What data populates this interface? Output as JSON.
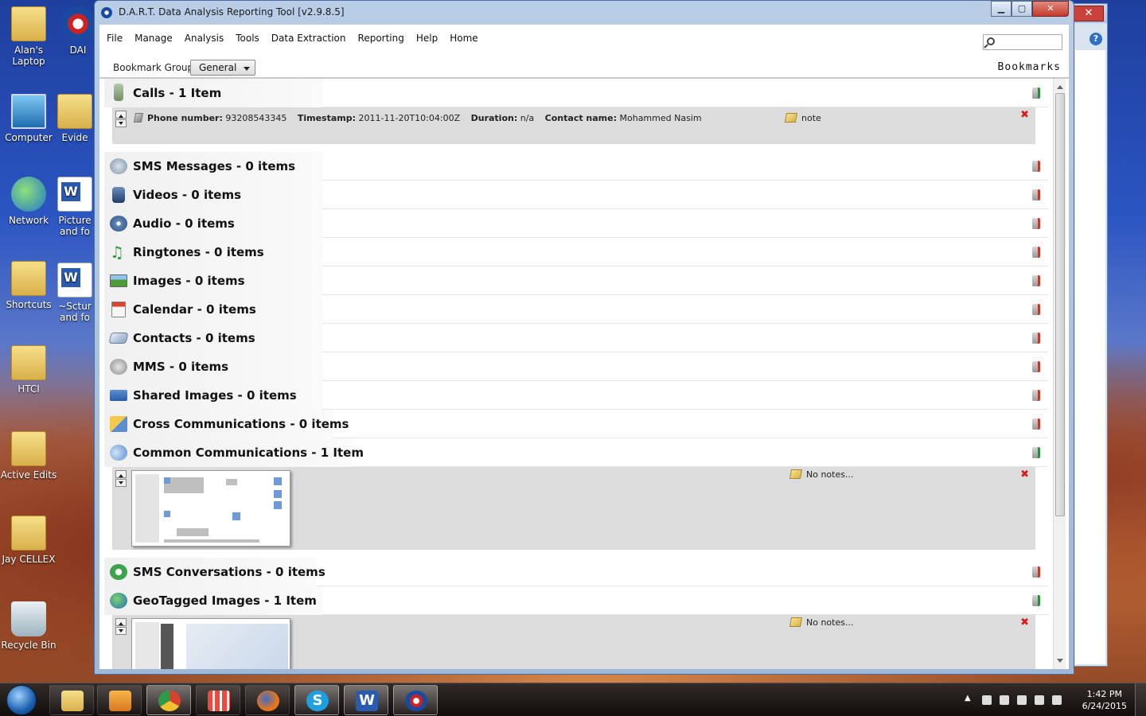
{
  "desktop": {
    "icons": [
      {
        "label": "Alan's\nLaptop"
      },
      {
        "label": "DAI"
      },
      {
        "label": "Computer"
      },
      {
        "label": "Evide"
      },
      {
        "label": "Network"
      },
      {
        "label": "Picture\nand fo"
      },
      {
        "label": "Shortcuts"
      },
      {
        "label": "~Sctur\nand fo"
      },
      {
        "label": "HTCI"
      },
      {
        "label": "Active Edits"
      },
      {
        "label": "Jay CELLEX"
      },
      {
        "label": "Recycle Bin"
      }
    ]
  },
  "window": {
    "title": "D.A.R.T. Data Analysis Reporting Tool [v2.9.8.5]",
    "menu": [
      "File",
      "Manage",
      "Analysis",
      "Tools",
      "Data Extraction",
      "Reporting",
      "Help",
      "Home"
    ],
    "search_placeholder": "",
    "bookmark_group_label": "Bookmark Group",
    "bookmark_group_value": "General",
    "panel_title": "Bookmarks"
  },
  "categories": [
    {
      "name": "Calls - 1 Item",
      "icon": "phone-icon",
      "flag": "green"
    },
    {
      "name": "SMS Messages - 0 items",
      "icon": "sms-icon",
      "flag": "red"
    },
    {
      "name": "Videos - 0 items",
      "icon": "film-icon",
      "flag": "red"
    },
    {
      "name": "Audio - 0 items",
      "icon": "audio-icon",
      "flag": "red"
    },
    {
      "name": "Ringtones - 0 items",
      "icon": "music-note-icon",
      "flag": "red"
    },
    {
      "name": "Images - 0 items",
      "icon": "image-icon",
      "flag": "red"
    },
    {
      "name": "Calendar - 0 items",
      "icon": "calendar-icon",
      "flag": "red"
    },
    {
      "name": "Contacts - 0 items",
      "icon": "contacts-icon",
      "flag": "red"
    },
    {
      "name": "MMS - 0 items",
      "icon": "mms-icon",
      "flag": "red"
    },
    {
      "name": "Shared Images - 0 items",
      "icon": "shared-images-icon",
      "flag": "red"
    },
    {
      "name": "Cross Communications - 0 items",
      "icon": "cross-communications-icon",
      "flag": "red"
    },
    {
      "name": "Common Communications - 1 Item",
      "icon": "common-communications-icon",
      "flag": "green"
    },
    {
      "name": "SMS Conversations - 0 items",
      "icon": "sms-conversations-icon",
      "flag": "red"
    },
    {
      "name": "GeoTagged Images - 1 Item",
      "icon": "globe-icon",
      "flag": "green"
    }
  ],
  "call_item": {
    "phone_label": "Phone number:",
    "phone_value": "93208543345",
    "timestamp_label": "Timestamp:",
    "timestamp_value": "2011-11-20T10:04:00Z",
    "duration_label": "Duration:",
    "duration_value": "n/a",
    "contact_label": "Contact name:",
    "contact_value": "Mohammed Nasim",
    "note": "note"
  },
  "common_item": {
    "note": "No notes..."
  },
  "geo_item": {
    "note": "No notes..."
  },
  "taskbar": {
    "time": "1:42 PM",
    "date": "6/24/2015",
    "apps": [
      "windows-explorer",
      "media-player",
      "chrome",
      "app-grid",
      "firefox",
      "skype",
      "word",
      "dart"
    ]
  },
  "colors": {
    "flag_red": "#c0392b",
    "flag_green": "#2e8b3a",
    "close_red": "#d21e1e",
    "detail_bg": "#dcdcdc"
  }
}
